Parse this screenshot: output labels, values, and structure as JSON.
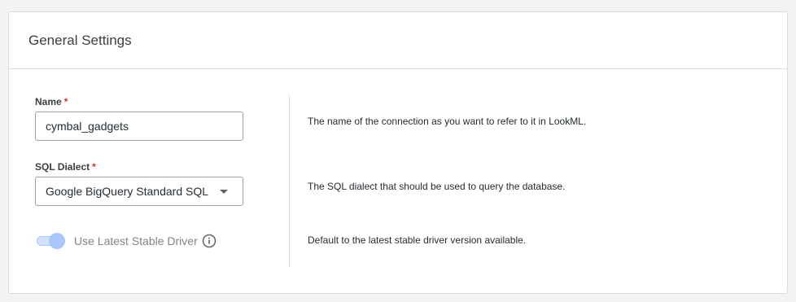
{
  "section": {
    "title": "General Settings"
  },
  "fields": {
    "name": {
      "label": "Name",
      "required_mark": "*",
      "value": "cymbal_gadgets",
      "description": "The name of the connection as you want to refer to it in LookML."
    },
    "dialect": {
      "label": "SQL Dialect",
      "required_mark": "*",
      "selected": "Google BigQuery Standard SQL",
      "description": "The SQL dialect that should be used to query the database."
    },
    "stable_driver": {
      "label": "Use Latest Stable Driver",
      "enabled": true,
      "icon": "info-icon",
      "description": "Default to the latest stable driver version available."
    }
  },
  "colors": {
    "required": "#d93025",
    "toggle_knob": "#a8c7fa",
    "border": "#dadce0"
  }
}
